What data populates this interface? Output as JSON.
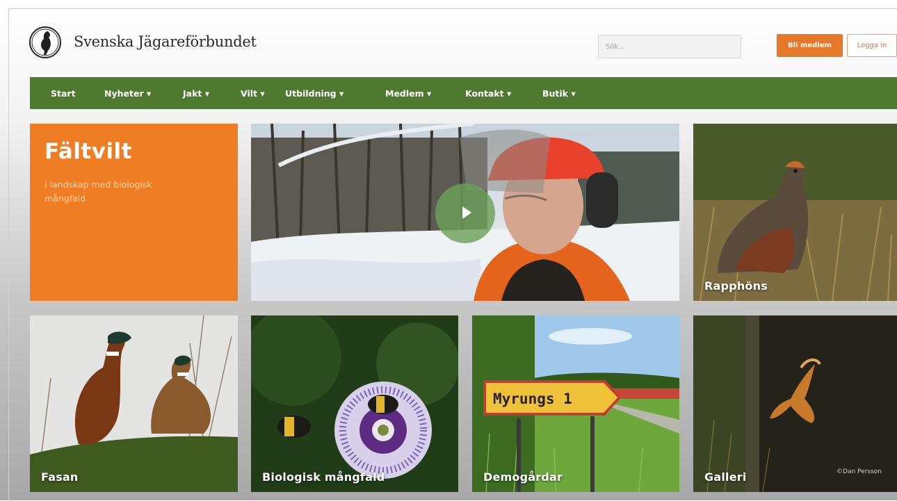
{
  "header": {
    "site_title": "Svenska Jägareförbundet",
    "search_placeholder": "Sök...",
    "member_button": "Bli medlem",
    "login_button": "Logga in",
    "logo_icon": "capercaillie-logo-icon"
  },
  "nav": {
    "items": [
      "Start",
      "Nyheter ▾",
      "Jakt ▾",
      "Vilt ▾",
      "Utbildning ▾",
      "Medlem ▾",
      "Kontakt ▾",
      "Butik ▾"
    ]
  },
  "feature": {
    "title": "Fältvilt",
    "subtitle": "i landskap med biologisk mångfald"
  },
  "video": {
    "play_icon": "play-icon"
  },
  "tiles": {
    "rapphons": "Rapphöns",
    "fasan": "Fasan",
    "bio": "Biologisk mångfald",
    "demo": "Demogårdar",
    "demo_sign_text": "Myrungs 1",
    "galleri": "Galleri",
    "galleri_credit": "©Dan Persson"
  },
  "colors": {
    "accent_orange": "#ee7d24",
    "nav_green": "#4d7a2e"
  }
}
